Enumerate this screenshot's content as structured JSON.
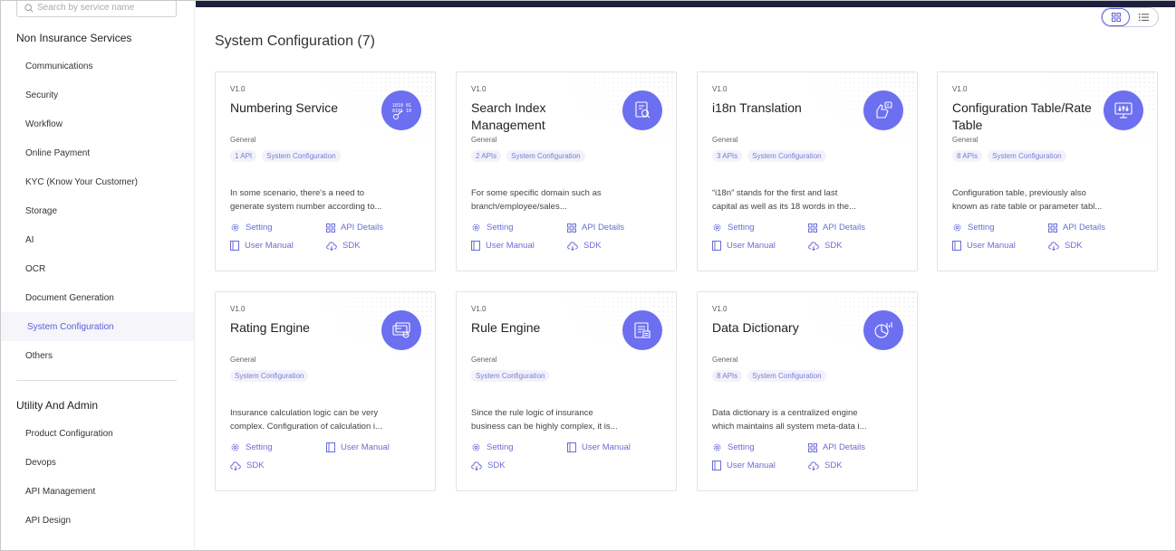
{
  "search": {
    "placeholder": "Search by service name"
  },
  "sidebar": {
    "section1": "Non Insurance Services",
    "items1": [
      "Communications",
      "Security",
      "Workflow",
      "Online Payment",
      "KYC (Know Your Customer)",
      "Storage",
      "AI",
      "OCR",
      "Document Generation",
      "System Configuration",
      "Others"
    ],
    "active_item": "System Configuration",
    "section2": "Utility And Admin",
    "items2": [
      "Product Configuration",
      "Devops",
      "API Management",
      "API Design"
    ]
  },
  "main": {
    "title": "System Configuration (7)",
    "view_modes": [
      "grid-icon",
      "list-icon"
    ],
    "accent": "#6c6ff0"
  },
  "links": {
    "setting": "Setting",
    "api_details": "API Details",
    "user_manual": "User Manual",
    "sdk": "SDK"
  },
  "cards": [
    {
      "version": "V1.0",
      "name": "Numbering Service",
      "category": "General",
      "tags": [
        "1 API",
        "System Configuration"
      ],
      "desc1": "In some scenario, there's a need to",
      "desc2": "generate system number according to...",
      "icon": "number-code-icon"
    },
    {
      "version": "V1.0",
      "name": "Search Index Management",
      "category": "General",
      "tags": [
        "2 APIs",
        "System Configuration"
      ],
      "desc1": "For some specific domain such as",
      "desc2": "branch/employee/sales...",
      "icon": "search-document-icon"
    },
    {
      "version": "V1.0",
      "name": "i18n Translation",
      "category": "General",
      "tags": [
        "3 APIs",
        "System Configuration"
      ],
      "desc1": "“i18n” stands for the first and last",
      "desc2": "capital as well as its 18 words in the...",
      "icon": "translation-icon"
    },
    {
      "version": "V1.0",
      "name": "Configuration Table/Rate Table",
      "category": "General",
      "tags": [
        "8 APIs",
        "System Configuration"
      ],
      "desc1": "Configuration table, previously also",
      "desc2": "known as rate table or parameter tabl...",
      "icon": "monitor-settings-icon"
    },
    {
      "version": "V1.0",
      "name": "Rating Engine",
      "category": "General",
      "tags": [
        "System Configuration"
      ],
      "desc1": "Insurance calculation logic can be very",
      "desc2": "complex. Configuration of calculation i...",
      "icon": "rating-card-icon"
    },
    {
      "version": "V1.0",
      "name": "Rule Engine",
      "category": "General",
      "tags": [
        "System Configuration"
      ],
      "desc1": "Since the rule logic of insurance",
      "desc2": "business can be highly complex, it is...",
      "icon": "rule-document-icon"
    },
    {
      "version": "V1.0",
      "name": "Data Dictionary",
      "category": "General",
      "tags": [
        "8 APIs",
        "System Configuration"
      ],
      "desc1": "Data dictionary is a centralized engine",
      "desc2": "which maintains all system meta-data i...",
      "icon": "data-chart-icon"
    }
  ]
}
